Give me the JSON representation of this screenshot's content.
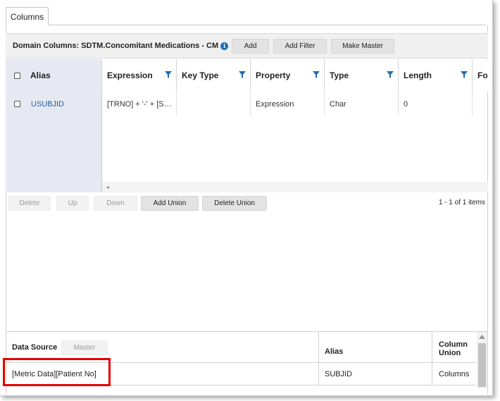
{
  "tabs": [
    {
      "label": "Columns"
    }
  ],
  "toolbar": {
    "title": "Domain Columns: SDTM.Concomitant Medications - CM",
    "info_icon": "info-icon",
    "buttons": [
      {
        "label": "Add"
      },
      {
        "label": "Add Filter"
      },
      {
        "label": "Make Master"
      }
    ]
  },
  "grid": {
    "columns": [
      {
        "label": "Alias"
      },
      {
        "label": "Expression"
      },
      {
        "label": "Key Type"
      },
      {
        "label": "Property"
      },
      {
        "label": "Type"
      },
      {
        "label": "Length"
      },
      {
        "label": "Fo"
      }
    ],
    "rows": [
      {
        "alias": "USUBJID",
        "expression": "[TRNO] + '-' + [S…",
        "key_type": "",
        "property": "Expression",
        "type": "Char",
        "length": "0"
      }
    ],
    "scroll_left_glyph": "◂"
  },
  "bottom_toolbar": {
    "buttons": [
      {
        "label": "Delete",
        "enabled": false
      },
      {
        "label": "Up",
        "enabled": false
      },
      {
        "label": "Down",
        "enabled": false
      },
      {
        "label": "Add Union",
        "enabled": true
      },
      {
        "label": "Delete Union",
        "enabled": true
      }
    ],
    "pager": "1 - 1 of 1 items"
  },
  "data_source": {
    "header_label": "Data Source",
    "master_button": "Master",
    "alias_header": "Alias",
    "column_union_header": "Column\nUnion",
    "rows": [
      {
        "source": "[Metric Data][Patient No]",
        "alias": "SUBJID",
        "column_union": "Columns"
      }
    ]
  },
  "colors": {
    "highlight": "#e00000",
    "link": "#1e5fa8",
    "filter_icon": "#1e6fb7"
  }
}
